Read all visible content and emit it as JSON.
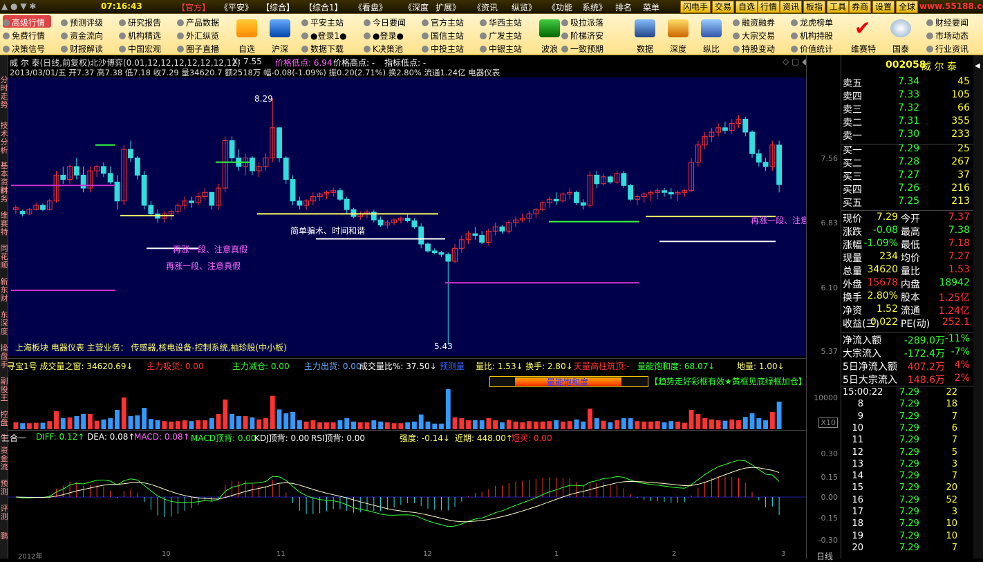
{
  "menubar": {
    "time": "07:16:43",
    "items": [
      "【官方】",
      "《平安》",
      "【综合】",
      "【综合1】",
      "《看盘》",
      "《深度",
      "扩展》",
      "《资讯",
      "纵览》",
      "《功能",
      "系统》",
      "排名",
      "菜单"
    ],
    "buttons": [
      "闪电手",
      "交易",
      "自选",
      "行情",
      "资讯",
      "板指",
      "工具",
      "券商",
      "设置",
      "全球"
    ],
    "watermark": "www.55188.com"
  },
  "toolbar": {
    "col1": [
      "高级行情",
      "免费行情",
      "决策信号"
    ],
    "col2": [
      "预测评级",
      "资金流向",
      "财报解读"
    ],
    "col3": [
      "研究报告",
      "机构精选",
      "中国宏观"
    ],
    "col4": [
      "产品数据",
      "外汇纵览",
      "圈子直播"
    ],
    "big1": [
      "自选",
      "沪深"
    ],
    "col5": [
      "平安主站",
      "●登录1●",
      "数据下载"
    ],
    "col6": [
      "今日要闻",
      "●登录●",
      "K决策池"
    ],
    "col7": [
      "官方主站",
      "国信主站",
      "中投主站"
    ],
    "col8": [
      "华西主站",
      "广发主站",
      "中银主站"
    ],
    "big2": "波浪",
    "col9": [
      "吸拉派落",
      "阶梯济安",
      "一致预期"
    ],
    "big3": [
      "数据",
      "深度",
      "纵比"
    ],
    "col10": [
      "融资融券",
      "大宗交易",
      "持股变动"
    ],
    "col11": [
      "龙虎榜单",
      "机构持股",
      "价值统计"
    ],
    "big4": [
      "维赛特",
      "国泰"
    ],
    "col12": [
      "财经要闻",
      "市场动态",
      "行业资讯"
    ]
  },
  "lefttabs": [
    "分时走势",
    "技术分析",
    "基本资料",
    "财务",
    "维赛特",
    "同花顺",
    "新东财",
    "东深度",
    "操盘手",
    "副股王",
    "控盘",
    "牛",
    "资金流",
    "预测",
    "评测",
    "鹏"
  ],
  "chart": {
    "title": "威 尔 泰(日线,前复权)",
    "indicator": "北沙博弈(0.01,12,12,12,12,12,12,12)",
    "x": "X: 7.55",
    "pricelow": "价格低点: 6.94",
    "pricehigh": "价格高点: -",
    "indlow": "指标低点: -",
    "ohlc": "2013/03/01/五 开7.37 高7.38 低7.18 收7.29 量34620.7 额2518万 幅-0.08(-1.09%) 振0.20(2.71%) 换2.80% 流通1.24亿 电器仪表",
    "maxlabel": "8.29",
    "minlabel": "5.43",
    "ann1": "再涨一段、注意真假",
    "ann2": "再涨一段、注意真假",
    "ann3": "简单骗术、时间和谐",
    "ann4": "再涨一段、注意",
    "footer": "上海板块   电器仪表      主营业务：  传感器,核电设备-控制系统,袖珍股(中小板)"
  },
  "volpanel": {
    "line1": "寻宝1号  成交量之窗: 34620.69↓",
    "l2": "主力吸货: 0.00",
    "l3": "主力减仓: 0.00",
    "l4": "主力出货: 0.00",
    "l5": "成交量比%: 37.50↓",
    "l6": "预测量",
    "l7": "量比: 1.53↓",
    "l8": "换手: 2.80↓",
    "l9": "天量高柱筑顶:-",
    "l10": "量能饱和度: 68.07↓",
    "l11": "地量: 1.00↓",
    "boxlabel": "量能饱和度",
    "tip": "【趋势走好彩框有效★黄框见底绿框加仓】",
    "axis": "10000",
    "x10": "X10"
  },
  "macdpanel": {
    "t1": "三合一",
    "t2": "DIFF: 0.12↑",
    "t3": "DEA: 0.08↑",
    "t4": "MACD: 0.08↑",
    "t5": "MACD顶背: 0.00",
    "t6": "KDJ顶背: 0.00",
    "t7": "RSI顶背: 0.00",
    "t8": "强度: -0.14↓",
    "t9": "近期: 448.00↑",
    "t10": "短买: 0.00",
    "axis": [
      "0.30",
      "0.15",
      "0.00",
      "-0.15",
      "-0.30"
    ]
  },
  "xaxis": [
    "2012年",
    "10",
    "11",
    "12",
    "1",
    "2",
    "3"
  ],
  "priceaxis": [
    "7.56",
    "6.83",
    "6.10",
    "5.37"
  ],
  "quote": {
    "code": "002058",
    "name": "威 尔 泰",
    "sell": [
      [
        "卖五",
        "7.34",
        "45"
      ],
      [
        "卖四",
        "7.33",
        "105"
      ],
      [
        "卖三",
        "7.32",
        "66"
      ],
      [
        "卖二",
        "7.31",
        "355"
      ],
      [
        "卖一",
        "7.30",
        "233"
      ]
    ],
    "buy": [
      [
        "买一",
        "7.29",
        "25"
      ],
      [
        "买二",
        "7.28",
        "267"
      ],
      [
        "买三",
        "7.27",
        "37"
      ],
      [
        "买四",
        "7.26",
        "216"
      ],
      [
        "买五",
        "7.25",
        "213"
      ]
    ],
    "stats": [
      [
        "现价",
        "7.29",
        "今开",
        "7.37"
      ],
      [
        "涨跌",
        "-0.08",
        "最高",
        "7.38"
      ],
      [
        "涨幅",
        "-1.09%",
        "最低",
        "7.18"
      ],
      [
        "现量",
        "234",
        "均价",
        "7.27"
      ],
      [
        "总量",
        "34620",
        "量比",
        "1.53"
      ],
      [
        "外盘",
        "15678",
        "内盘",
        "18942"
      ],
      [
        "换手",
        "2.80%",
        "股本",
        "1.25亿"
      ],
      [
        "净资",
        "1.52",
        "流通",
        "1.24亿"
      ],
      [
        "收益(三)",
        "0.022",
        "PE(动)",
        "252.1"
      ]
    ],
    "flows": [
      [
        "净流入额",
        "-289.0万",
        "-11%"
      ],
      [
        "大宗流入",
        "-172.4万",
        "-7%"
      ],
      [
        "5日净流入额",
        "407.2万",
        "4%"
      ],
      [
        "5日大宗流入",
        "148.6万",
        "2%"
      ]
    ],
    "ticks": [
      [
        "15:00:22",
        "7.29",
        "22"
      ],
      [
        "8",
        "7.29",
        "18"
      ],
      [
        "9",
        "7.29",
        "7"
      ],
      [
        "10",
        "7.29",
        "6"
      ],
      [
        "11",
        "7.29",
        "7"
      ],
      [
        "12",
        "7.29",
        "5"
      ],
      [
        "13",
        "7.29",
        "3"
      ],
      [
        "14",
        "7.29",
        "7"
      ],
      [
        "15",
        "7.29",
        "20"
      ],
      [
        "16",
        "7.29",
        "52"
      ],
      [
        "17",
        "7.29",
        "3"
      ],
      [
        "18",
        "7.29",
        "10"
      ],
      [
        "19",
        "7.29",
        "10"
      ],
      [
        "20",
        "7.29",
        "7"
      ]
    ],
    "bottomtab": "日线"
  },
  "candles": [
    [
      7.0,
      7.05,
      6.95,
      7.02
    ],
    [
      6.98,
      7.0,
      6.92,
      6.95
    ],
    [
      6.95,
      7.02,
      6.94,
      7.0
    ],
    [
      7.0,
      7.08,
      6.99,
      7.05
    ],
    [
      7.05,
      7.07,
      6.98,
      7.0
    ],
    [
      7.0,
      7.12,
      6.99,
      7.1
    ],
    [
      7.1,
      7.45,
      7.08,
      7.4
    ],
    [
      7.4,
      7.5,
      7.3,
      7.35
    ],
    [
      7.35,
      7.52,
      7.3,
      7.5
    ],
    [
      7.5,
      7.6,
      7.35,
      7.4
    ],
    [
      7.4,
      7.5,
      7.2,
      7.25
    ],
    [
      7.25,
      7.5,
      7.2,
      7.45
    ],
    [
      7.45,
      7.52,
      7.38,
      7.5
    ],
    [
      7.5,
      7.55,
      7.38,
      7.42
    ],
    [
      7.42,
      7.5,
      7.3,
      7.32
    ],
    [
      7.32,
      7.4,
      7.0,
      7.1
    ],
    [
      7.1,
      7.75,
      7.05,
      7.7
    ],
    [
      7.7,
      7.8,
      7.55,
      7.6
    ],
    [
      7.6,
      7.62,
      7.35,
      7.4
    ],
    [
      7.4,
      7.45,
      7.0,
      7.05
    ],
    [
      7.05,
      7.1,
      6.92,
      6.95
    ],
    [
      6.95,
      7.0,
      6.85,
      6.9
    ],
    [
      6.9,
      6.98,
      6.85,
      6.95
    ],
    [
      6.95,
      7.0,
      6.88,
      6.98
    ],
    [
      6.98,
      7.08,
      6.95,
      7.05
    ],
    [
      7.05,
      7.15,
      7.0,
      7.1
    ],
    [
      7.1,
      7.15,
      7.02,
      7.08
    ],
    [
      7.08,
      7.2,
      7.05,
      7.15
    ],
    [
      7.15,
      7.25,
      7.1,
      7.2
    ],
    [
      7.2,
      7.2,
      7.0,
      7.05
    ],
    [
      7.05,
      7.3,
      7.0,
      7.25
    ],
    [
      7.25,
      7.85,
      7.2,
      7.8
    ],
    [
      7.8,
      7.85,
      7.55,
      7.6
    ],
    [
      7.6,
      7.7,
      7.45,
      7.5
    ],
    [
      7.5,
      7.65,
      7.4,
      7.6
    ],
    [
      7.6,
      7.62,
      7.4,
      7.45
    ],
    [
      7.45,
      7.55,
      7.38,
      7.5
    ],
    [
      7.5,
      7.65,
      7.45,
      7.6
    ],
    [
      7.6,
      8.29,
      7.55,
      7.95
    ],
    [
      7.95,
      7.96,
      7.55,
      7.6
    ],
    [
      7.6,
      7.62,
      7.3,
      7.35
    ],
    [
      7.35,
      7.4,
      7.05,
      7.1
    ],
    [
      7.1,
      7.15,
      7.0,
      7.05
    ],
    [
      7.05,
      7.12,
      7.0,
      7.1
    ],
    [
      7.1,
      7.2,
      7.05,
      7.15
    ],
    [
      7.15,
      7.2,
      7.1,
      7.18
    ],
    [
      7.18,
      7.22,
      7.12,
      7.2
    ],
    [
      7.2,
      7.25,
      7.15,
      7.22
    ],
    [
      7.22,
      7.25,
      7.1,
      7.12
    ],
    [
      7.12,
      7.15,
      6.95,
      7.0
    ],
    [
      7.0,
      7.02,
      6.9,
      6.92
    ],
    [
      6.92,
      6.98,
      6.88,
      6.95
    ],
    [
      6.95,
      7.0,
      6.9,
      6.97
    ],
    [
      6.97,
      7.0,
      6.85,
      6.88
    ],
    [
      6.88,
      6.92,
      6.8,
      6.82
    ],
    [
      6.82,
      6.88,
      6.78,
      6.85
    ],
    [
      6.85,
      6.9,
      6.82,
      6.88
    ],
    [
      6.88,
      6.92,
      6.84,
      6.9
    ],
    [
      6.9,
      6.95,
      6.85,
      6.87
    ],
    [
      6.87,
      6.9,
      6.78,
      6.8
    ],
    [
      6.8,
      6.84,
      6.55,
      6.6
    ],
    [
      6.6,
      6.62,
      6.5,
      6.52
    ],
    [
      6.52,
      6.55,
      6.48,
      6.5
    ],
    [
      6.5,
      6.52,
      6.45,
      6.48
    ],
    [
      6.48,
      6.5,
      5.43,
      6.4
    ],
    [
      6.4,
      6.6,
      6.38,
      6.55
    ],
    [
      6.55,
      6.7,
      6.5,
      6.65
    ],
    [
      6.65,
      6.75,
      6.6,
      6.72
    ],
    [
      6.72,
      6.8,
      6.65,
      6.7
    ],
    [
      6.7,
      6.75,
      6.6,
      6.62
    ],
    [
      6.62,
      6.78,
      6.58,
      6.75
    ],
    [
      6.75,
      6.85,
      6.7,
      6.8
    ],
    [
      6.8,
      6.82,
      6.72,
      6.75
    ],
    [
      6.75,
      6.88,
      6.72,
      6.85
    ],
    [
      6.85,
      6.92,
      6.8,
      6.88
    ],
    [
      6.88,
      6.95,
      6.85,
      6.9
    ],
    [
      6.9,
      6.98,
      6.85,
      6.95
    ],
    [
      6.95,
      7.02,
      6.9,
      7.0
    ],
    [
      7.0,
      7.1,
      6.98,
      7.08
    ],
    [
      7.08,
      7.15,
      7.02,
      7.12
    ],
    [
      7.12,
      7.2,
      7.05,
      7.1
    ],
    [
      7.1,
      7.2,
      7.08,
      7.18
    ],
    [
      7.18,
      7.25,
      7.12,
      7.2
    ],
    [
      7.2,
      7.22,
      7.05,
      7.08
    ],
    [
      7.08,
      7.12,
      7.0,
      7.05
    ],
    [
      7.05,
      7.45,
      7.02,
      7.4
    ],
    [
      7.4,
      7.45,
      7.25,
      7.3
    ],
    [
      7.3,
      7.42,
      7.28,
      7.38
    ],
    [
      7.38,
      7.4,
      7.3,
      7.32
    ],
    [
      7.32,
      7.45,
      7.3,
      7.42
    ],
    [
      7.42,
      7.45,
      7.25,
      7.28
    ],
    [
      7.28,
      7.3,
      7.1,
      7.12
    ],
    [
      7.12,
      7.18,
      7.05,
      7.15
    ],
    [
      7.15,
      7.2,
      7.08,
      7.18
    ],
    [
      7.18,
      7.22,
      7.1,
      7.2
    ],
    [
      7.2,
      7.25,
      7.12,
      7.22
    ],
    [
      7.22,
      7.25,
      7.15,
      7.2
    ],
    [
      7.2,
      7.25,
      7.12,
      7.18
    ],
    [
      7.18,
      7.22,
      7.1,
      7.2
    ],
    [
      7.2,
      7.24,
      7.15,
      7.22
    ],
    [
      7.22,
      7.6,
      7.2,
      7.55
    ],
    [
      7.55,
      7.8,
      7.5,
      7.75
    ],
    [
      7.75,
      7.9,
      7.7,
      7.85
    ],
    [
      7.85,
      7.95,
      7.78,
      7.9
    ],
    [
      7.9,
      8.0,
      7.85,
      7.95
    ],
    [
      7.95,
      8.02,
      7.88,
      7.92
    ],
    [
      7.92,
      8.05,
      7.88,
      8.0
    ],
    [
      8.0,
      8.1,
      7.95,
      8.05
    ],
    [
      8.05,
      8.08,
      7.85,
      7.9
    ],
    [
      7.9,
      7.92,
      7.6,
      7.65
    ],
    [
      7.65,
      7.7,
      7.5,
      7.55
    ],
    [
      7.55,
      7.6,
      7.45,
      7.5
    ],
    [
      7.5,
      7.8,
      7.45,
      7.75
    ],
    [
      7.75,
      7.8,
      7.2,
      7.29
    ]
  ]
}
